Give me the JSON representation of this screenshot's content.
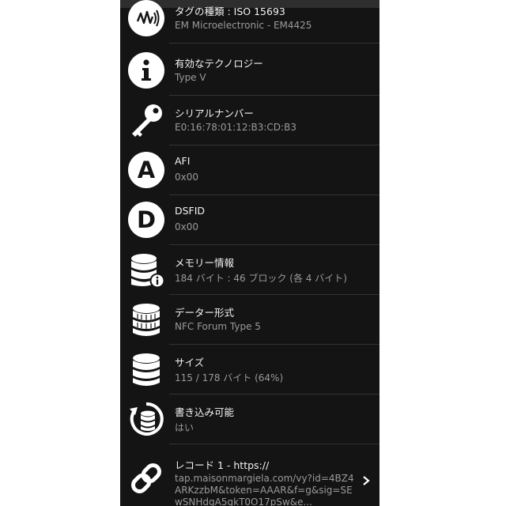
{
  "items": [
    {
      "icon": "nfc-icon",
      "title": "タグの種類 : ISO 15693",
      "sub": "EM Microelectronic - EM4425"
    },
    {
      "icon": "info-icon",
      "title": "有効なテクノロジー",
      "sub": "Type V"
    },
    {
      "icon": "key-icon",
      "title": "シリアルナンバー",
      "sub": "E0:16:78:01:12:B3:CD:B3"
    },
    {
      "icon": "letter-a-icon",
      "letter": "A",
      "title": "AFI",
      "sub": "0x00"
    },
    {
      "icon": "letter-d-icon",
      "letter": "D",
      "title": "DSFID",
      "sub": "0x00"
    },
    {
      "icon": "database-info-icon",
      "title": "メモリー情報",
      "sub": "184 バイト : 46 ブロック (各 4 バイト)"
    },
    {
      "icon": "database-format-icon",
      "title": "データー形式",
      "sub": "NFC Forum Type 5"
    },
    {
      "icon": "database-size-icon",
      "title": "サイズ",
      "sub": "115 / 178 バイト (64%)"
    },
    {
      "icon": "database-write-icon",
      "title": "書き込み可能",
      "sub": "はい"
    }
  ],
  "record": {
    "icon": "link-icon",
    "title": "レコード 1 - https://",
    "sub": "tap.maisonmargiela.com/vy?id=4BZ4ARKzzbM&token=AAAR&f=g&sig=SEwSNHdgA5gkT0O17pSw&e..."
  },
  "colors": {
    "background": "#141414",
    "text": "#f2f2f2",
    "subtext": "#9a9a9a",
    "icon": "#ffffff"
  }
}
